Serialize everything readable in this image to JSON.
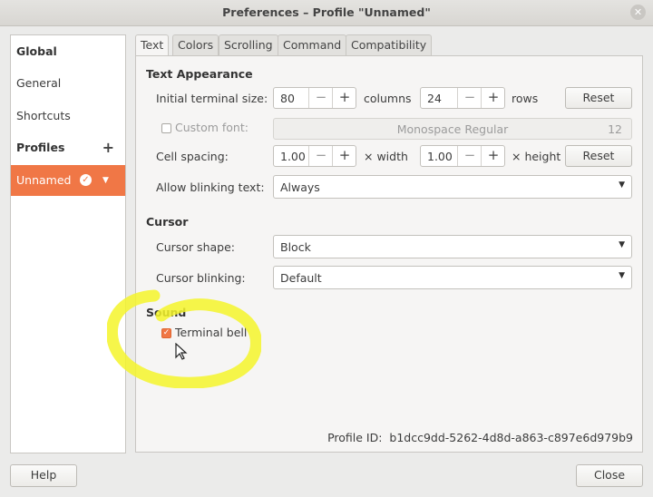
{
  "window": {
    "title": "Preferences – Profile \"Unnamed\""
  },
  "sidebar": {
    "global": "Global",
    "general": "General",
    "shortcuts": "Shortcuts",
    "profiles": "Profiles",
    "profile_active": "Unnamed"
  },
  "tabs": [
    "Text",
    "Colors",
    "Scrolling",
    "Command",
    "Compatibility"
  ],
  "text_appearance": {
    "heading": "Text Appearance",
    "initial_size_label": "Initial terminal size:",
    "columns_value": "80",
    "columns_label": "columns",
    "rows_value": "24",
    "rows_label": "rows",
    "reset_label": "Reset",
    "custom_font_label": "Custom font:",
    "font_name": "Monospace Regular",
    "font_size": "12",
    "cell_spacing_label": "Cell spacing:",
    "width_value": "1.00",
    "width_label": "× width",
    "height_value": "1.00",
    "height_label": "× height",
    "blinking_text_label": "Allow blinking text:",
    "blinking_text_value": "Always"
  },
  "cursor": {
    "heading": "Cursor",
    "shape_label": "Cursor shape:",
    "shape_value": "Block",
    "blinking_label": "Cursor blinking:",
    "blinking_value": "Default"
  },
  "sound": {
    "heading": "Sound",
    "terminal_bell_label": "Terminal bell",
    "terminal_bell_checked": true
  },
  "profile_id": {
    "label": "Profile ID:",
    "value": "b1dcc9dd-5262-4d8d-a863-c897e6d979b9"
  },
  "footer": {
    "help": "Help",
    "close": "Close"
  },
  "colors": {
    "accent": "#f07746",
    "highlight": "#f4f52a"
  }
}
